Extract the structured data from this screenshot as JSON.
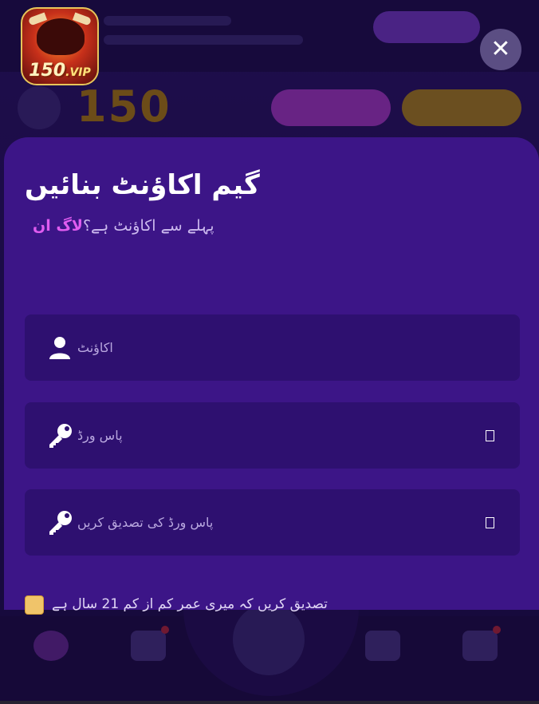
{
  "app": {
    "icon_badge_number": "150",
    "icon_badge_suffix": ".VIP",
    "close_symbol": "✕"
  },
  "register": {
    "title": "گیم اکاؤنٹ بنائیں",
    "have_account_text": "پہلے سے اکاؤنٹ ہے؟",
    "login_link": "لاگ ان",
    "fields": {
      "account": {
        "placeholder": "اکاؤنٹ",
        "value": "",
        "icon": "user-icon"
      },
      "password": {
        "placeholder": "پاس ورڈ",
        "value": "",
        "icon": "key-icon"
      },
      "confirm_password": {
        "placeholder": "پاس ورڈ کی تصدیق کریں",
        "value": "",
        "icon": "key-icon"
      }
    },
    "age_confirm_text": "تصدیق کریں کہ میری عمر کم از کم 21 سال ہے",
    "age_checked": true
  },
  "colors": {
    "sheet_bg": "#3c1587",
    "field_bg": "#2e1070",
    "link": "#e05cf0",
    "checkbox": "#f0c46a"
  }
}
